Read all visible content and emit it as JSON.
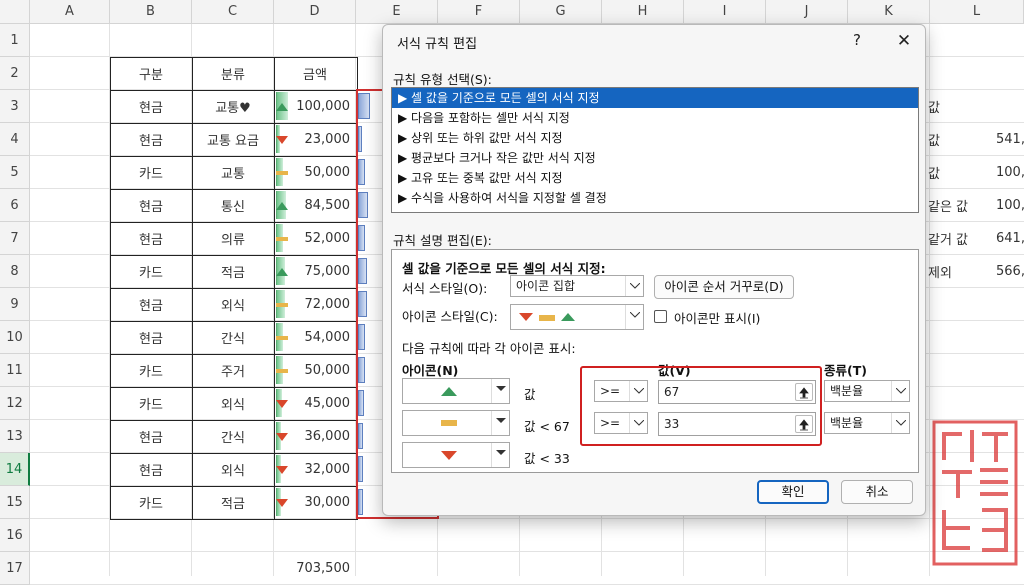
{
  "spreadsheet": {
    "columns": [
      "A",
      "B",
      "C",
      "D",
      "E",
      "F",
      "G",
      "H",
      "I",
      "J",
      "K",
      "L"
    ],
    "rows": [
      "1",
      "2",
      "3",
      "4",
      "5",
      "6",
      "7",
      "8",
      "9",
      "10",
      "11",
      "12",
      "13",
      "14",
      "15",
      "16",
      "17"
    ],
    "selected_row": "14",
    "header": {
      "b": "구분",
      "c": "분류",
      "d": "금액"
    },
    "data": [
      {
        "b": "현금",
        "c": "교통♥",
        "d": "100,000",
        "icon": "up",
        "pct": 1.0
      },
      {
        "b": "현금",
        "c": "교통 요금",
        "d": "23,000",
        "icon": "down",
        "pct": 0.0
      },
      {
        "b": "카드",
        "c": "교통",
        "d": "50,000",
        "icon": "mid",
        "pct": 0.35
      },
      {
        "b": "현금",
        "c": "통신",
        "d": "84,500",
        "icon": "up",
        "pct": 0.8
      },
      {
        "b": "현금",
        "c": "의류",
        "d": "52,000",
        "icon": "mid",
        "pct": 0.38
      },
      {
        "b": "카드",
        "c": "적금",
        "d": "75,000",
        "icon": "up",
        "pct": 0.67
      },
      {
        "b": "현금",
        "c": "외식",
        "d": "72,000",
        "icon": "mid",
        "pct": 0.64
      },
      {
        "b": "현금",
        "c": "간식",
        "d": "54,000",
        "icon": "mid",
        "pct": 0.4
      },
      {
        "b": "카드",
        "c": "주거",
        "d": "50,000",
        "icon": "mid",
        "pct": 0.35
      },
      {
        "b": "카드",
        "c": "외식",
        "d": "45,000",
        "icon": "down",
        "pct": 0.29
      },
      {
        "b": "현금",
        "c": "간식",
        "d": "36,000",
        "icon": "down",
        "pct": 0.17
      },
      {
        "b": "현금",
        "c": "외식",
        "d": "32,000",
        "icon": "down",
        "pct": 0.12
      },
      {
        "b": "카드",
        "c": "적금",
        "d": "30,000",
        "icon": "down",
        "pct": 0.09
      }
    ],
    "total": "703,500",
    "k_col": [
      "값",
      "값",
      "값",
      "같은 값",
      "같거 값",
      "제외"
    ],
    "l_col": [
      "",
      "541,",
      "100,",
      "100,",
      "641,",
      "566,"
    ]
  },
  "dialog": {
    "title": "서식 규칙 편집",
    "help": "?",
    "close": "✕",
    "rule_type_label": "규칙 유형 선택(S):",
    "rule_types": [
      "▶ 셀 값을 기준으로 모든 셀의 서식 지정",
      "▶ 다음을 포함하는 셀만 서식 지정",
      "▶ 상위 또는 하위 값만 서식 지정",
      "▶ 평균보다 크거나 작은 값만 서식 지정",
      "▶ 고유 또는 중복 값만 서식 지정",
      "▶ 수식을 사용하여 서식을 지정할 셀 결정"
    ],
    "desc_label": "규칙 설명 편집(E):",
    "desc_heading": "셀 값을 기준으로 모든 셀의 서식 지정:",
    "format_style_label": "서식 스타일(O):",
    "format_style_value": "아이콘 집합",
    "reverse_button": "아이콘 순서 거꾸로(D)",
    "icon_style_label": "아이콘 스타일(C):",
    "icon_only_label": "아이콘만 표시(I)",
    "rule_caption": "다음 규칙에 따라 각 아이콘 표시:",
    "icon_header": "아이콘(N)",
    "value_header": "값(V)",
    "type_header": "종류(T)",
    "rules": [
      {
        "cond": "값",
        "op": ">=",
        "value": "67",
        "type": "백분율"
      },
      {
        "cond": "값 < 67",
        "op": ">=",
        "value": "33",
        "type": "백분율"
      },
      {
        "cond": "값 < 33"
      }
    ],
    "ok": "확인",
    "cancel": "취소"
  },
  "colors": {
    "accent": "#1565c0",
    "highlight": "#d02020",
    "up": "#3a9a5c",
    "mid": "#e8b54a",
    "down": "#d9472b"
  }
}
